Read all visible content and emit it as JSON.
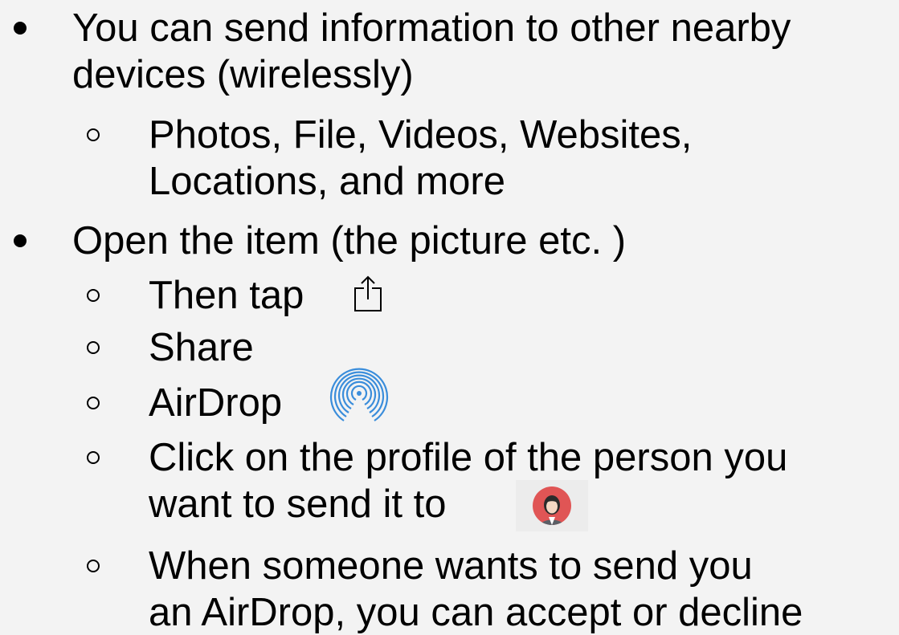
{
  "items": [
    {
      "level": 1,
      "lines": [
        "You can send information to other nearby",
        "devices (wirelessly)"
      ]
    },
    {
      "level": 2,
      "lines": [
        "Photos, File, Videos, Websites,",
        "Locations, and more"
      ]
    },
    {
      "level": 1,
      "lines": [
        "Open the item (the picture etc. )"
      ]
    },
    {
      "level": 2,
      "lines": [
        "Then tap"
      ],
      "icon": "share-icon"
    },
    {
      "level": 2,
      "lines": [
        "Share"
      ]
    },
    {
      "level": 2,
      "lines": [
        "AirDrop"
      ],
      "icon": "airdrop-icon"
    },
    {
      "level": 2,
      "lines": [
        "Click on the profile of the person you",
        "want to send it to"
      ],
      "icon": "profile-avatar-icon"
    },
    {
      "level": 2,
      "lines": [
        "When someone wants to send you",
        "an AirDrop, you can accept or decline"
      ]
    }
  ],
  "colors": {
    "background": "#f3f3f3",
    "text": "#000000",
    "airdrop_blue": "#3a8ddb",
    "avatar_red": "#e05555"
  }
}
